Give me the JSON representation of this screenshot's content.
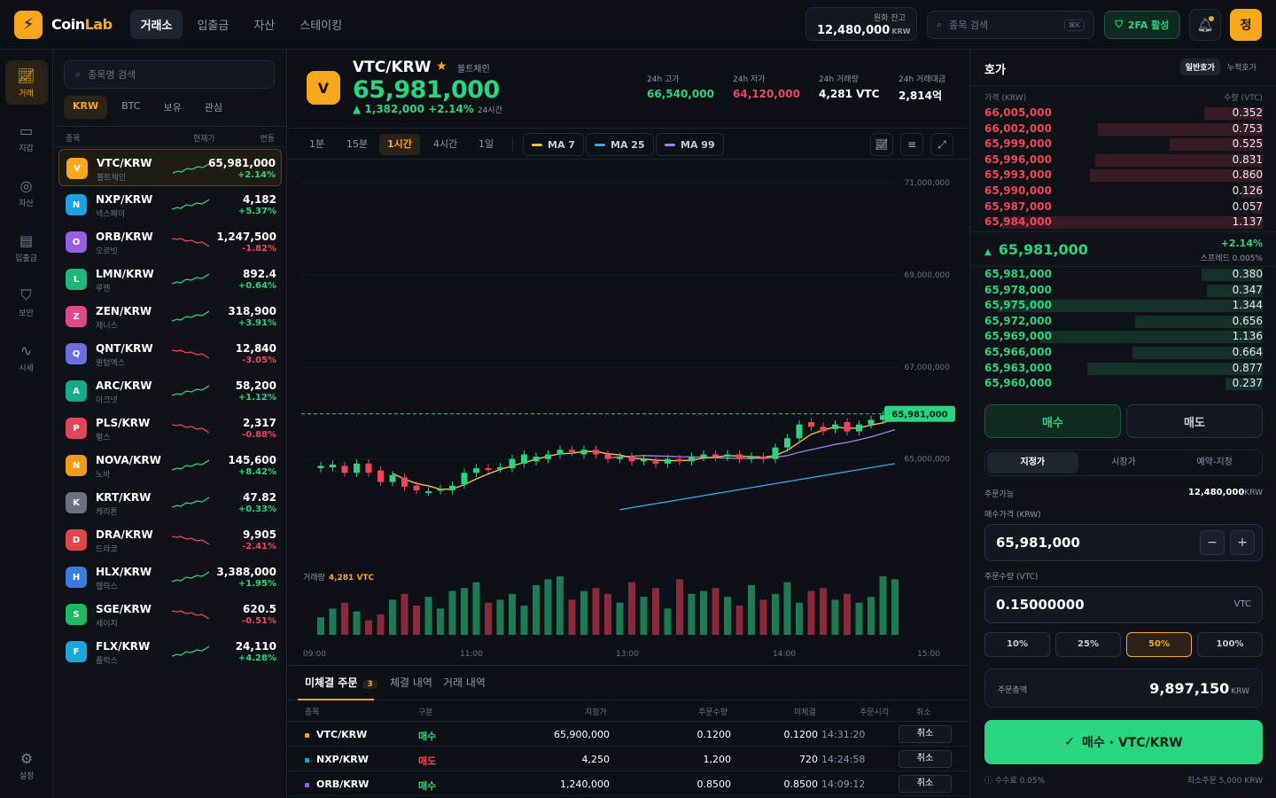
{
  "header": {
    "brand_a": "Coin",
    "brand_b": "Lab",
    "nav": [
      "거래소",
      "입출금",
      "자산",
      "스테이킹"
    ],
    "balance_label": "원화 잔고",
    "balance_value": "12,480,000",
    "balance_unit": "KRW",
    "search_placeholder": "종목 검색",
    "search_kbd": "⌘K",
    "twofa": "2FA 활성",
    "avatar": "정"
  },
  "rail": [
    "거래",
    "지갑",
    "자산",
    "입출금",
    "보안",
    "시세"
  ],
  "rail_bottom": "설정",
  "market": {
    "search_placeholder": "종목명 검색",
    "tabs": [
      "KRW",
      "BTC",
      "보유",
      "관심"
    ],
    "head": {
      "name": "종목",
      "price": "현재가",
      "change": "변동"
    },
    "rows": [
      {
        "letter": "V",
        "color": "#f7a81b",
        "sym": "VTC/KRW",
        "name": "볼트체인",
        "price": "65,981,000",
        "chg": "+2.14%",
        "up": true
      },
      {
        "letter": "N",
        "color": "#1aa3e0",
        "sym": "NXP/KRW",
        "name": "넥스페이",
        "price": "4,182",
        "chg": "+5.37%",
        "up": true
      },
      {
        "letter": "O",
        "color": "#9b5de5",
        "sym": "ORB/KRW",
        "name": "오르빗",
        "price": "1,247,500",
        "chg": "-1.82%",
        "up": false
      },
      {
        "letter": "L",
        "color": "#1db97a",
        "sym": "LMN/KRW",
        "name": "루멘",
        "price": "892.4",
        "chg": "+0.64%",
        "up": true
      },
      {
        "letter": "Z",
        "color": "#e0488c",
        "sym": "ZEN/KRW",
        "name": "제니스",
        "price": "318,900",
        "chg": "+3.91%",
        "up": true
      },
      {
        "letter": "Q",
        "color": "#6b6ee0",
        "sym": "QNT/KRW",
        "name": "퀀텀엑스",
        "price": "12,840",
        "chg": "-3.05%",
        "up": false
      },
      {
        "letter": "A",
        "color": "#16a98a",
        "sym": "ARC/KRW",
        "name": "아크넷",
        "price": "58,200",
        "chg": "+1.12%",
        "up": true
      },
      {
        "letter": "P",
        "color": "#e0455a",
        "sym": "PLS/KRW",
        "name": "펄스",
        "price": "2,317",
        "chg": "-0.88%",
        "up": false
      },
      {
        "letter": "N",
        "color": "#f29a1a",
        "sym": "NOVA/KRW",
        "name": "노바",
        "price": "145,600",
        "chg": "+8.42%",
        "up": true
      },
      {
        "letter": "K",
        "color": "#6c7180",
        "sym": "KRT/KRW",
        "name": "케리톤",
        "price": "47.82",
        "chg": "+0.33%",
        "up": true
      },
      {
        "letter": "D",
        "color": "#e0454a",
        "sym": "DRA/KRW",
        "name": "드라코",
        "price": "9,905",
        "chg": "-2.41%",
        "up": false
      },
      {
        "letter": "H",
        "color": "#3a7be0",
        "sym": "HLX/KRW",
        "name": "헬릭스",
        "price": "3,388,000",
        "chg": "+1.95%",
        "up": true
      },
      {
        "letter": "S",
        "color": "#1db960",
        "sym": "SGE/KRW",
        "name": "세이지",
        "price": "620.5",
        "chg": "-0.51%",
        "up": false
      },
      {
        "letter": "F",
        "color": "#1aa8d8",
        "sym": "FLX/KRW",
        "name": "플럭스",
        "price": "24,110",
        "chg": "+4.28%",
        "up": true
      }
    ]
  },
  "ticker": {
    "letter": "V",
    "symbol": "VTC/KRW",
    "name": "볼트체인",
    "price": "65,981,000",
    "change": "▲ 1,382,000  +2.14%",
    "period": "24시간",
    "stats": [
      {
        "label": "24h 고가",
        "value": "66,540,000",
        "tone": "up"
      },
      {
        "label": "24h 저가",
        "value": "64,120,000",
        "tone": "dn"
      },
      {
        "label": "24h 거래량",
        "value": "4,281 VTC",
        "tone": "plain"
      },
      {
        "label": "24h 거래대금",
        "value": "2,814억",
        "tone": "plain"
      }
    ]
  },
  "toolbar": {
    "timeframes": [
      "1분",
      "15분",
      "1시간",
      "4시간",
      "1일"
    ],
    "active_tf": 2,
    "ma": [
      {
        "label": "MA 7",
        "color": "#f7c23a"
      },
      {
        "label": "MA 25",
        "color": "#3aa8f0"
      },
      {
        "label": "MA 99",
        "color": "#a67cf0"
      }
    ]
  },
  "chart_data": {
    "type": "candlestick",
    "y_ticks": [
      "71,000,000",
      "69,000,000",
      "67,000,000",
      "65,000,000"
    ],
    "ylim": [
      63800000,
      71500000
    ],
    "last_price": "65,981,000",
    "x_ticks": [
      "09:00",
      "11:00",
      "13:00",
      "14:00",
      "15:00"
    ],
    "volume_label": "거래량",
    "volume_value": "4,281 VTC",
    "candles": [
      {
        "o": 64800000,
        "c": 64850000
      },
      {
        "o": 64820000,
        "c": 64880000
      },
      {
        "o": 64850000,
        "c": 64700000
      },
      {
        "o": 64700000,
        "c": 64900000
      },
      {
        "o": 64900000,
        "c": 64700000
      },
      {
        "o": 64750000,
        "c": 64500000
      },
      {
        "o": 64500000,
        "c": 64650000
      },
      {
        "o": 64600000,
        "c": 64400000
      },
      {
        "o": 64420000,
        "c": 64320000
      },
      {
        "o": 64300000,
        "c": 64300000
      },
      {
        "o": 64320000,
        "c": 64350000
      },
      {
        "o": 64320000,
        "c": 64420000
      },
      {
        "o": 64450000,
        "c": 64700000
      },
      {
        "o": 64700000,
        "c": 64800000
      },
      {
        "o": 64800000,
        "c": 64780000
      },
      {
        "o": 64800000,
        "c": 64820000
      },
      {
        "o": 64800000,
        "c": 65000000
      },
      {
        "o": 64900000,
        "c": 65100000
      },
      {
        "o": 64950000,
        "c": 65050000
      },
      {
        "o": 65000000,
        "c": 65100000
      },
      {
        "o": 65100000,
        "c": 65200000
      },
      {
        "o": 65200000,
        "c": 65150000
      },
      {
        "o": 65100000,
        "c": 65200000
      },
      {
        "o": 65200000,
        "c": 65100000
      },
      {
        "o": 65100000,
        "c": 65000000
      },
      {
        "o": 65000000,
        "c": 65050000
      },
      {
        "o": 65050000,
        "c": 64950000
      },
      {
        "o": 64950000,
        "c": 65000000
      },
      {
        "o": 64950000,
        "c": 64900000
      },
      {
        "o": 64900000,
        "c": 65000000
      },
      {
        "o": 65000000,
        "c": 64950000
      },
      {
        "o": 64950000,
        "c": 65050000
      },
      {
        "o": 65050000,
        "c": 65100000
      },
      {
        "o": 65100000,
        "c": 65050000
      },
      {
        "o": 65050000,
        "c": 65100000
      },
      {
        "o": 65100000,
        "c": 65000000
      },
      {
        "o": 65000000,
        "c": 65050000
      },
      {
        "o": 65050000,
        "c": 65000000
      },
      {
        "o": 65000000,
        "c": 65250000
      },
      {
        "o": 65250000,
        "c": 65450000
      },
      {
        "o": 65450000,
        "c": 65750000
      },
      {
        "o": 65800000,
        "c": 65700000
      },
      {
        "o": 65700000,
        "c": 65600000
      },
      {
        "o": 65650000,
        "c": 65750000
      },
      {
        "o": 65800000,
        "c": 65600000
      },
      {
        "o": 65600000,
        "c": 65750000
      },
      {
        "o": 65750000,
        "c": 65850000
      },
      {
        "o": 65850000,
        "c": 65950000
      },
      {
        "o": 65950000,
        "c": 65981000
      }
    ],
    "volumes": [
      30,
      45,
      55,
      40,
      25,
      35,
      60,
      70,
      50,
      65,
      45,
      75,
      80,
      90,
      55,
      60,
      70,
      50,
      85,
      95,
      100,
      60,
      75,
      80,
      70,
      55,
      90,
      65,
      80,
      45,
      95,
      70,
      75,
      80,
      65,
      50,
      85,
      60,
      70,
      90,
      55,
      75,
      80,
      60,
      70,
      55,
      65,
      100,
      95
    ]
  },
  "orders": {
    "tabs": [
      "미체결 주문",
      "체결 내역",
      "거래 내역"
    ],
    "open_count": "3",
    "head": [
      "종목",
      "구분",
      "지정가",
      "주문수량",
      "미체결",
      "주문시각",
      "취소"
    ],
    "rows": [
      {
        "sym": "VTC/KRW",
        "dot": "#f7a81b",
        "side": "매수",
        "buy": true,
        "price": "65,900,000",
        "qty": "0.1200",
        "remain": "0.1200",
        "time": "14:31:20"
      },
      {
        "sym": "NXP/KRW",
        "dot": "#1aa3e0",
        "side": "매도",
        "buy": false,
        "price": "4,250",
        "qty": "1,200",
        "remain": "720",
        "time": "14:24:58"
      },
      {
        "sym": "ORB/KRW",
        "dot": "#9b5de5",
        "side": "매수",
        "buy": true,
        "price": "1,240,000",
        "qty": "0.8500",
        "remain": "0.8500",
        "time": "14:09:12"
      }
    ],
    "cancel": "취소"
  },
  "orderbook": {
    "title": "호가",
    "modes": [
      "일반호가",
      "누적호가"
    ],
    "head_price": "가격 (KRW)",
    "head_qty": "수량 (VTC)",
    "asks": [
      {
        "p": "66,005,000",
        "q": "0.352",
        "w": 0.22
      },
      {
        "p": "66,002,000",
        "q": "0.753",
        "w": 0.62
      },
      {
        "p": "65,999,000",
        "q": "0.525",
        "w": 0.35
      },
      {
        "p": "65,996,000",
        "q": "0.831",
        "w": 0.63
      },
      {
        "p": "65,993,000",
        "q": "0.860",
        "w": 0.65
      },
      {
        "p": "65,990,000",
        "q": "0.126",
        "w": 0.08
      },
      {
        "p": "65,987,000",
        "q": "0.057",
        "w": 0.04
      },
      {
        "p": "65,984,000",
        "q": "1.137",
        "w": 0.98
      }
    ],
    "mid_price": "65,981,000",
    "mid_change": "+2.14%",
    "spread": "스프레드 0.005%",
    "bids": [
      {
        "p": "65,981,000",
        "q": "0.380",
        "w": 0.23
      },
      {
        "p": "65,978,000",
        "q": "0.347",
        "w": 0.21
      },
      {
        "p": "65,975,000",
        "q": "1.344",
        "w": 1.0
      },
      {
        "p": "65,972,000",
        "q": "0.656",
        "w": 0.48
      },
      {
        "p": "65,969,000",
        "q": "1.136",
        "w": 0.84
      },
      {
        "p": "65,966,000",
        "q": "0.664",
        "w": 0.49
      },
      {
        "p": "65,963,000",
        "q": "0.877",
        "w": 0.66
      },
      {
        "p": "65,960,000",
        "q": "0.237",
        "w": 0.14
      }
    ]
  },
  "form": {
    "buy": "매수",
    "sell": "매도",
    "types": [
      "지정가",
      "시장가",
      "예약-지정"
    ],
    "avail_label": "주문가능",
    "avail_value": "12,480,000",
    "avail_unit": "KRW",
    "price_label": "매수가격 (KRW)",
    "price_value": "65,981,000",
    "qty_label": "주문수량 (VTC)",
    "qty_value": "0.15000000",
    "qty_unit": "VTC",
    "pcts": [
      "10%",
      "25%",
      "50%",
      "100%"
    ],
    "active_pct": 2,
    "total_label": "주문총액",
    "total_value": "9,897,150",
    "total_unit": "KRW",
    "submit": "매수 · VTC/KRW",
    "fee": "수수료 0.05%",
    "min_order": "최소주문 5,000 KRW"
  }
}
